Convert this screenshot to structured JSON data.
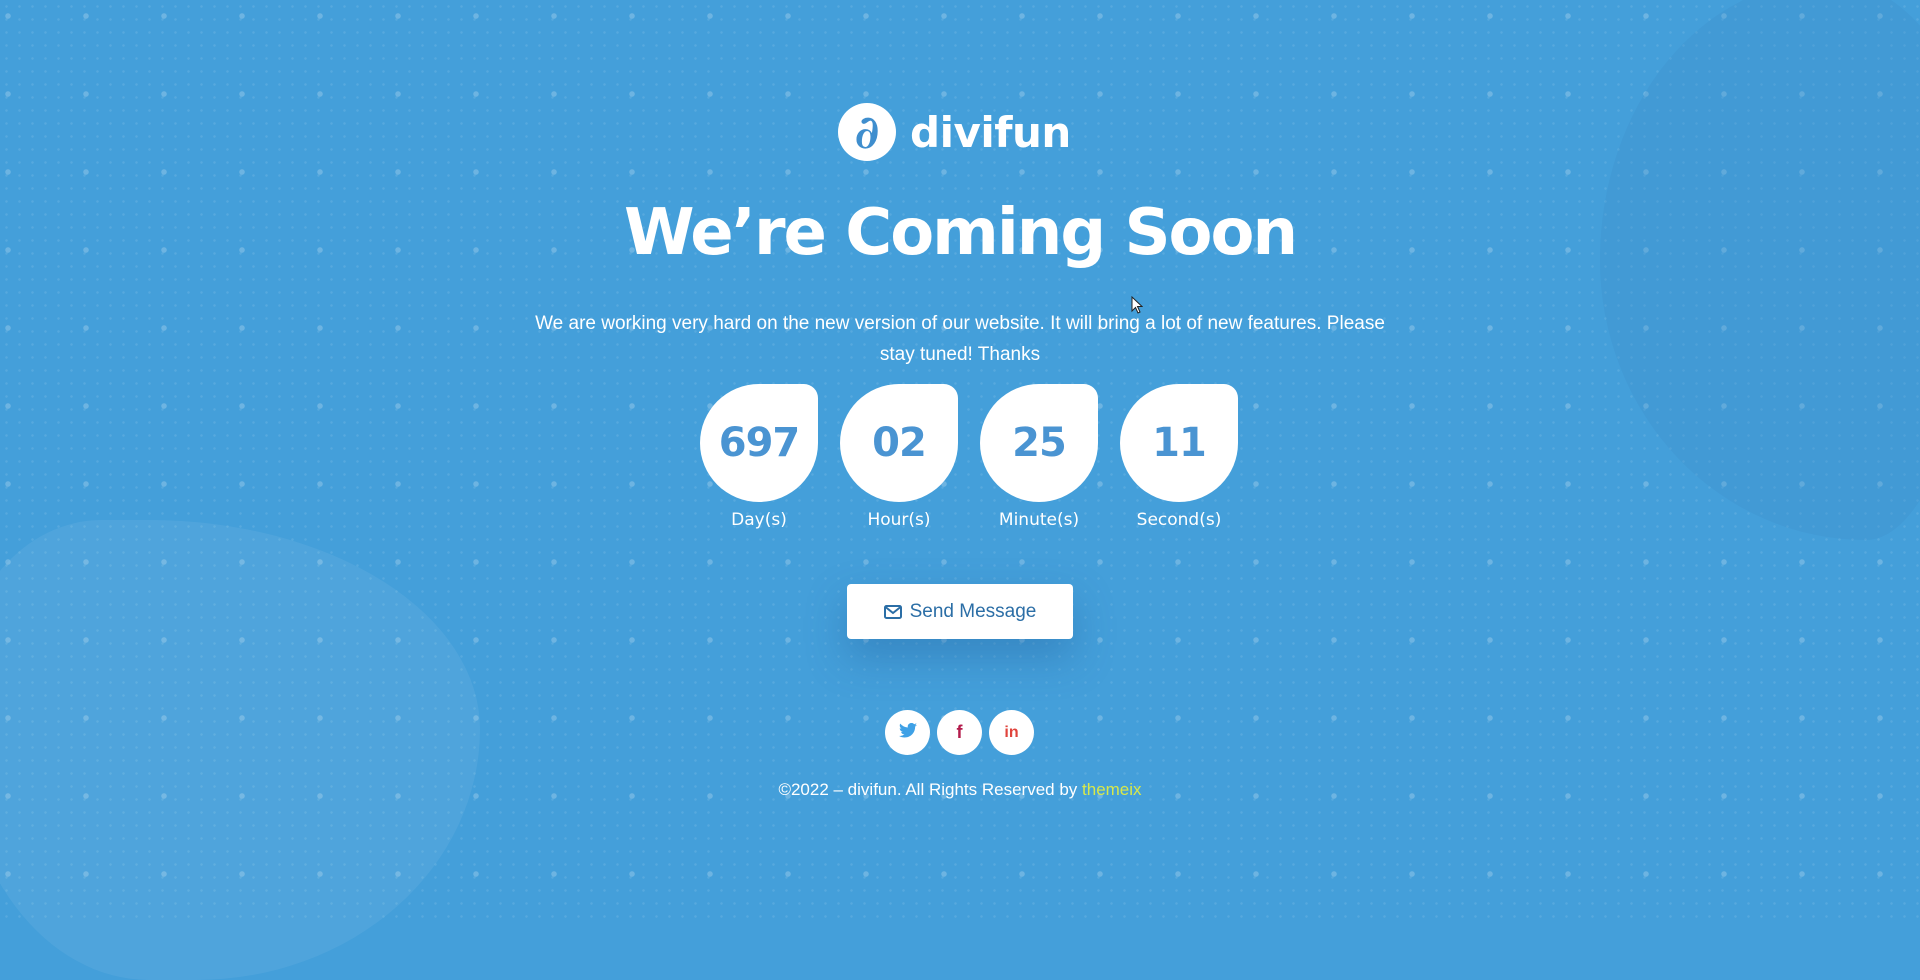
{
  "brand": {
    "logo_glyph": "∂",
    "name": "divifun"
  },
  "hero": {
    "title": "We’re Coming Soon",
    "description": "We are working very hard on the new version of our website. It will bring a  lot of new features. Please stay tuned! Thanks"
  },
  "countdown": [
    {
      "value": "697",
      "label": "Day(s)"
    },
    {
      "value": "02",
      "label": "Hour(s)"
    },
    {
      "value": "25",
      "label": "Minute(s)"
    },
    {
      "value": "11",
      "label": "Second(s)"
    }
  ],
  "cta": {
    "icon": "envelope-icon",
    "label": "Send Message"
  },
  "socials": [
    {
      "icon": "twitter-icon",
      "glyph": "t",
      "color": "#3fa1e6"
    },
    {
      "icon": "facebook-icon",
      "glyph": "f",
      "color": "#b41c4c"
    },
    {
      "icon": "linkedin-icon",
      "glyph": "in",
      "color": "#e0443c"
    }
  ],
  "footer": {
    "text": "©2022 – divifun. All Rights Reserved by ",
    "link_label": "themeix",
    "link_color": "#d8e84a"
  },
  "theme": {
    "background": "#449fda",
    "accent": "#4a94d2"
  }
}
